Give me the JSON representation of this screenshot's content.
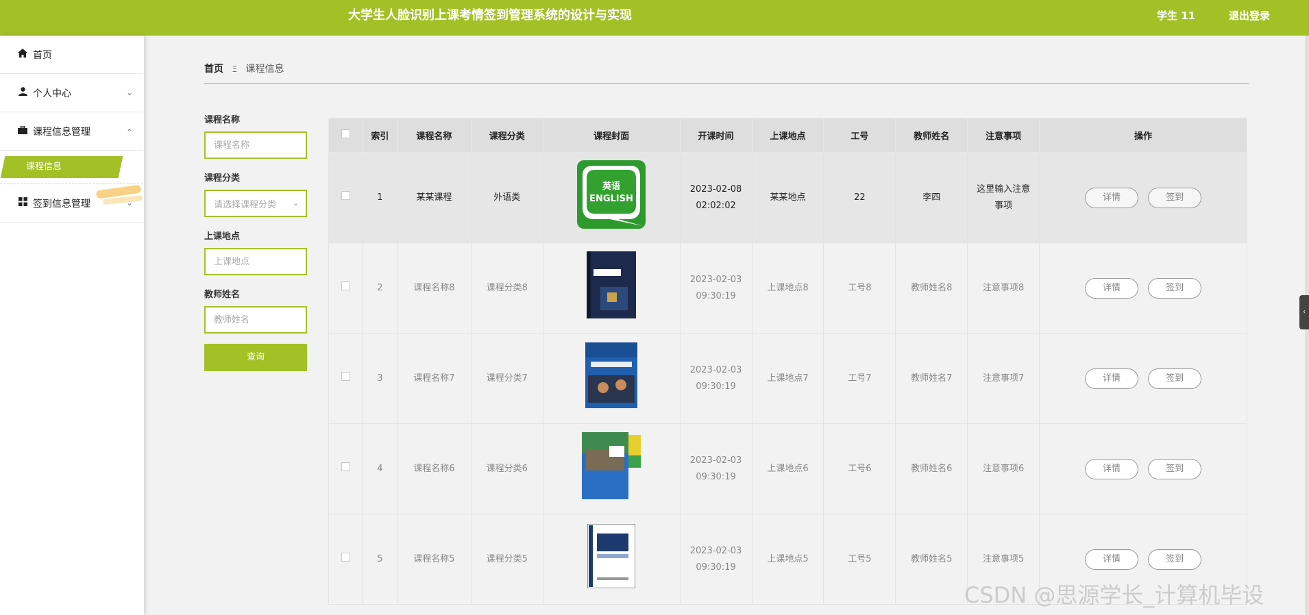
{
  "header": {
    "title": "大学生人脸识别上课考情签到管理系统的设计与实现",
    "user": "学生 11",
    "logout": "退出登录"
  },
  "sidebar": {
    "items": [
      {
        "label": "首页",
        "icon": "home-icon"
      },
      {
        "label": "个人中心",
        "icon": "user-icon"
      },
      {
        "label": "课程信息管理",
        "icon": "briefcase-icon"
      },
      {
        "label": "签到信息管理",
        "icon": "grid-icon"
      }
    ],
    "active_sub": "课程信息"
  },
  "breadcrumb": {
    "home": "首页",
    "current": "课程信息"
  },
  "filters": {
    "course_name_label": "课程名称",
    "course_name_placeholder": "课程名称",
    "category_label": "课程分类",
    "category_placeholder": "请选择课程分类",
    "location_label": "上课地点",
    "location_placeholder": "上课地点",
    "teacher_label": "教师姓名",
    "teacher_placeholder": "教师姓名",
    "query_button": "查询"
  },
  "table": {
    "headers": [
      "索引",
      "课程名称",
      "课程分类",
      "课程封面",
      "开课时间",
      "上课地点",
      "工号",
      "教师姓名",
      "注意事项",
      "操作"
    ],
    "detail_label": "详情",
    "signin_label": "签到",
    "rows": [
      {
        "index": "1",
        "name": "某某课程",
        "category": "外语类",
        "cover": "english-cover",
        "date": "2023-02-08",
        "time": "02:02:02",
        "location": "某某地点",
        "job_no": "22",
        "teacher": "李四",
        "note": "这里输入注意事项"
      },
      {
        "index": "2",
        "name": "课程名称8",
        "category": "课程分类8",
        "cover": "math-book-cover",
        "date": "2023-02-03",
        "time": "09:30:19",
        "location": "上课地点8",
        "job_no": "工号8",
        "teacher": "教师姓名8",
        "note": "注意事项8"
      },
      {
        "index": "3",
        "name": "课程名称7",
        "category": "课程分类7",
        "cover": "blue-book-cover",
        "date": "2023-02-03",
        "time": "09:30:19",
        "location": "上课地点7",
        "job_no": "工号7",
        "teacher": "教师姓名7",
        "note": "注意事项7"
      },
      {
        "index": "4",
        "name": "课程名称6",
        "category": "课程分类6",
        "cover": "physics-book-cover",
        "date": "2023-02-03",
        "time": "09:30:19",
        "location": "上课地点6",
        "job_no": "工号6",
        "teacher": "教师姓名6",
        "note": "注意事项6"
      },
      {
        "index": "5",
        "name": "课程名称5",
        "category": "课程分类5",
        "cover": "science-book-cover",
        "date": "2023-02-03",
        "time": "09:30:19",
        "location": "上课地点5",
        "job_no": "工号5",
        "teacher": "教师姓名5",
        "note": "注意事项5"
      }
    ]
  },
  "watermark": "CSDN @思源学长_计算机毕设",
  "colors": {
    "accent": "#a3c127",
    "background": "#f2f2f2"
  }
}
